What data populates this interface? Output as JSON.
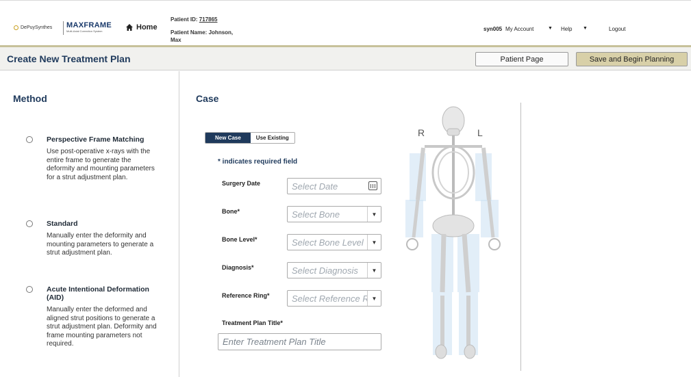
{
  "header": {
    "depuy_logo": "DePuySynthes",
    "maxframe_logo": "MAXFRAME",
    "maxframe_sub": "Multi-Axial Correction System",
    "home_label": "Home",
    "patient_id_label": "Patient ID:",
    "patient_id_value": "717865",
    "patient_name_label": "Patient Name:",
    "patient_name_value": "Johnson,",
    "patient_name_value2": "Max",
    "user": "syn005",
    "my_account": "My Account",
    "help": "Help",
    "logout": "Logout"
  },
  "subbar": {
    "title": "Create New Treatment Plan",
    "patient_page_button": "Patient Page",
    "save_button": "Save and Begin Planning"
  },
  "method": {
    "heading": "Method",
    "options": [
      {
        "title": "Perspective Frame Matching",
        "description": "Use post-operative x-rays with the entire frame to generate the deformity and mounting parameters for a strut adjustment plan."
      },
      {
        "title": "Standard",
        "description": "Manually enter the deformity and mounting parameters to generate a strut adjustment plan."
      },
      {
        "title": "Acute Intentional Deformation (AID)",
        "description": "Manually enter the deformed and aligned strut positions to generate a strut adjustment plan. Deformity and frame mounting parameters not required."
      }
    ]
  },
  "case": {
    "heading": "Case",
    "tab_new": "New Case",
    "tab_existing": "Use Existing",
    "required_note": "* indicates required field",
    "surgery_date_label": "Surgery Date",
    "surgery_date_placeholder": "Select Date",
    "bone_label": "Bone*",
    "bone_placeholder": "Select Bone",
    "bone_level_label": "Bone Level*",
    "bone_level_placeholder": "Select Bone Level",
    "diagnosis_label": "Diagnosis*",
    "diagnosis_placeholder": "Select Diagnosis",
    "reference_ring_label": "Reference Ring*",
    "reference_ring_placeholder": "Select Reference R",
    "plan_title_label": "Treatment Plan Title*",
    "plan_title_placeholder": "Enter Treatment Plan Title"
  },
  "skeleton": {
    "right_label": "R",
    "left_label": "L"
  },
  "colors": {
    "brand_navy": "#1f3a5c",
    "save_button_bg": "#d8d0a8",
    "header_accent": "#c7c19a",
    "bone_highlight": "#cfe3f4"
  }
}
